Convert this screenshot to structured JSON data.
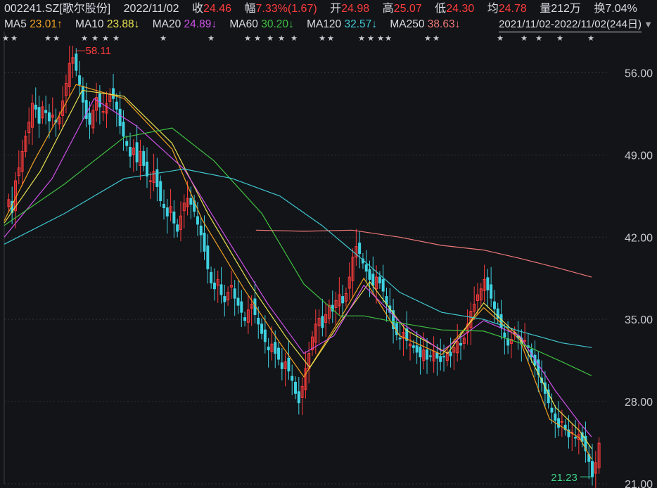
{
  "header": {
    "code": "002241.SZ[歌尔股份]",
    "date": "2022/11/02",
    "close_label": "收",
    "close": "24.46",
    "change_label": "幅",
    "change": "7.33%(1.67)",
    "open_label": "开",
    "open": "24.98",
    "high_label": "高",
    "high": "25.07",
    "low_label": "低",
    "low": "24.30",
    "avg_label": "均",
    "avg": "24.78",
    "volume_label": "量",
    "volume": "212万",
    "turnover_label": "换",
    "turnover": "7.04%"
  },
  "ma_legend": [
    {
      "label": "MA5",
      "value": "23.01↑",
      "color": "#f0a020"
    },
    {
      "label": "MA10",
      "value": "23.88↓",
      "color": "#e8e050"
    },
    {
      "label": "MA20",
      "value": "24.89↓",
      "color": "#d050e8"
    },
    {
      "label": "MA60",
      "value": "30.20↓",
      "color": "#40c040"
    },
    {
      "label": "MA120",
      "value": "32.57↓",
      "color": "#40c8d0"
    },
    {
      "label": "MA250",
      "value": "38.63↓",
      "color": "#f07878"
    }
  ],
  "range_text": "2021/11/02-2022/11/02(244日)",
  "range_arrow": "▼",
  "colors": {
    "up": "#ff3c3c",
    "down": "#3fd1e0",
    "bg": "#121418",
    "grid": "#2e3238",
    "axis_text": "#c8ccd2"
  },
  "chart_data": {
    "type": "candlestick",
    "ylim": [
      21.0,
      59.5
    ],
    "yticks": [
      56.0,
      49.0,
      42.0,
      35.0,
      28.0,
      21.0
    ],
    "ytick_labels": [
      "56.00",
      "49.00",
      "42.00",
      "35.00",
      "28.00",
      "21.00"
    ],
    "max_label": "58.11",
    "min_label": "21.23",
    "star_marker": "★",
    "close_series": [
      45.2,
      44.1,
      46.8,
      47.9,
      49.3,
      50.6,
      51.8,
      53.4,
      52.9,
      51.7,
      53.1,
      52.6,
      51.9,
      52.4,
      51.8,
      52.2,
      53.6,
      55.1,
      56.8,
      57.3,
      56.2,
      55.0,
      53.5,
      52.1,
      51.6,
      52.8,
      53.9,
      53.1,
      52.7,
      53.4,
      54.2,
      53.8,
      52.9,
      51.5,
      50.6,
      49.8,
      48.9,
      49.6,
      48.4,
      49.3,
      48.1,
      47.2,
      46.8,
      47.6,
      46.3,
      45.1,
      44.5,
      43.8,
      44.6,
      43.2,
      42.5,
      43.8,
      44.9,
      45.3,
      44.8,
      44.2,
      43.1,
      42.2,
      40.8,
      39.3,
      38.1,
      37.6,
      38.4,
      37.1,
      36.5,
      37.3,
      37.9,
      36.8,
      36.2,
      35.6,
      34.9,
      35.8,
      36.3,
      35.4,
      34.6,
      33.8,
      33.1,
      32.4,
      32.9,
      32.1,
      31.6,
      30.8,
      31.4,
      30.6,
      29.8,
      28.7,
      27.9,
      29.3,
      30.8,
      32.1,
      33.5,
      34.6,
      35.1,
      34.3,
      35.4,
      36.2,
      35.7,
      36.6,
      37.1,
      36.4,
      37.2,
      38.6,
      40.3,
      41.2,
      40.6,
      39.8,
      39.1,
      38.4,
      37.9,
      38.6,
      38.1,
      37.4,
      36.3,
      35.6,
      34.2,
      33.7,
      33.4,
      33.9,
      33.2,
      32.9,
      32.6,
      32.2,
      31.8,
      32.4,
      31.6,
      31.9,
      32.3,
      31.7,
      31.4,
      31.8,
      32.2,
      31.9,
      32.6,
      33.1,
      32.8,
      33.4,
      34.6,
      35.7,
      36.3,
      37.1,
      37.6,
      38.4,
      37.5,
      36.8,
      35.9,
      35.1,
      34.3,
      33.5,
      32.8,
      33.3,
      33.9,
      33.4,
      32.9,
      33.2,
      32.6,
      31.8,
      31.1,
      30.3,
      29.6,
      28.7,
      27.9,
      27.1,
      26.4,
      25.8,
      26.3,
      25.6,
      25.0,
      25.4,
      24.9,
      25.2,
      24.6,
      23.8,
      22.9,
      21.6,
      22.8,
      24.46
    ],
    "ma_paths": {
      "MA5": [
        [
          0,
          43.4
        ],
        [
          0.05,
          48.5
        ],
        [
          0.12,
          55.0
        ],
        [
          0.2,
          53.8
        ],
        [
          0.28,
          49.5
        ],
        [
          0.33,
          43.5
        ],
        [
          0.4,
          37.6
        ],
        [
          0.46,
          33.0
        ],
        [
          0.5,
          30.1
        ],
        [
          0.56,
          35.0
        ],
        [
          0.6,
          38.5
        ],
        [
          0.66,
          33.6
        ],
        [
          0.73,
          32.0
        ],
        [
          0.8,
          36.0
        ],
        [
          0.86,
          33.3
        ],
        [
          0.91,
          26.5
        ],
        [
          0.96,
          24.9
        ],
        [
          0.98,
          23.1
        ]
      ],
      "MA10": [
        [
          0,
          43.2
        ],
        [
          0.06,
          47.6
        ],
        [
          0.13,
          54.5
        ],
        [
          0.2,
          54.0
        ],
        [
          0.28,
          50.0
        ],
        [
          0.34,
          44.0
        ],
        [
          0.41,
          38.0
        ],
        [
          0.47,
          33.5
        ],
        [
          0.51,
          30.9
        ],
        [
          0.56,
          34.7
        ],
        [
          0.61,
          38.2
        ],
        [
          0.67,
          34.1
        ],
        [
          0.74,
          32.1
        ],
        [
          0.8,
          36.4
        ],
        [
          0.86,
          33.5
        ],
        [
          0.92,
          27.5
        ],
        [
          0.96,
          25.5
        ],
        [
          0.98,
          24.0
        ]
      ],
      "MA20": [
        [
          0,
          42.0
        ],
        [
          0.08,
          47.0
        ],
        [
          0.15,
          53.8
        ],
        [
          0.22,
          51.5
        ],
        [
          0.3,
          47.8
        ],
        [
          0.37,
          42.0
        ],
        [
          0.44,
          36.3
        ],
        [
          0.5,
          32.1
        ],
        [
          0.55,
          33.6
        ],
        [
          0.6,
          37.9
        ],
        [
          0.66,
          34.8
        ],
        [
          0.73,
          32.3
        ],
        [
          0.8,
          34.9
        ],
        [
          0.86,
          33.6
        ],
        [
          0.92,
          28.9
        ],
        [
          0.96,
          26.2
        ],
        [
          0.98,
          25.0
        ]
      ],
      "MA60": [
        [
          0,
          43.0
        ],
        [
          0.1,
          46.5
        ],
        [
          0.2,
          50.5
        ],
        [
          0.28,
          51.3
        ],
        [
          0.35,
          48.5
        ],
        [
          0.43,
          44.0
        ],
        [
          0.5,
          38.0
        ],
        [
          0.56,
          35.3
        ],
        [
          0.6,
          35.3
        ],
        [
          0.66,
          34.7
        ],
        [
          0.73,
          34.1
        ],
        [
          0.8,
          34.0
        ],
        [
          0.86,
          33.0
        ],
        [
          0.93,
          31.4
        ],
        [
          0.98,
          30.2
        ]
      ],
      "MA120": [
        [
          0,
          41.4
        ],
        [
          0.1,
          44.0
        ],
        [
          0.2,
          47.0
        ],
        [
          0.3,
          47.8
        ],
        [
          0.38,
          47.0
        ],
        [
          0.46,
          45.5
        ],
        [
          0.53,
          43.0
        ],
        [
          0.6,
          40.0
        ],
        [
          0.66,
          37.3
        ],
        [
          0.73,
          35.6
        ],
        [
          0.8,
          35.0
        ],
        [
          0.86,
          34.0
        ],
        [
          0.93,
          33.0
        ],
        [
          0.98,
          32.6
        ]
      ],
      "MA250": [
        [
          0.42,
          42.6
        ],
        [
          0.5,
          42.5
        ],
        [
          0.58,
          42.6
        ],
        [
          0.66,
          42.0
        ],
        [
          0.73,
          41.3
        ],
        [
          0.8,
          40.9
        ],
        [
          0.86,
          40.2
        ],
        [
          0.93,
          39.3
        ],
        [
          0.98,
          38.6
        ]
      ]
    }
  }
}
